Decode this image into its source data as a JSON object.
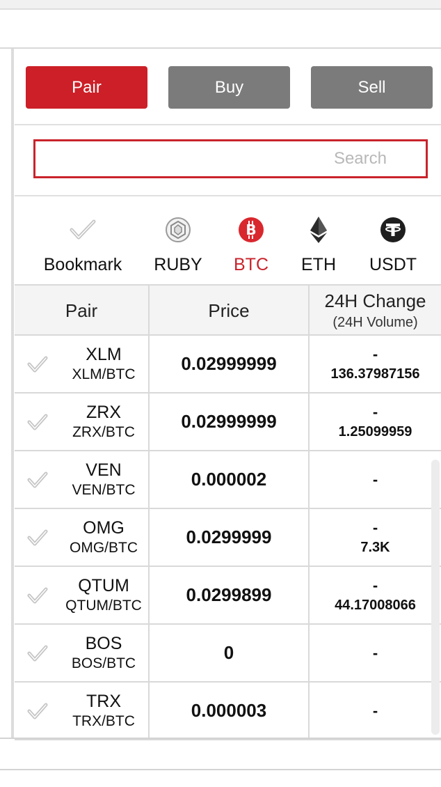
{
  "tabs": [
    {
      "label": "Pair",
      "active": true
    },
    {
      "label": "Buy",
      "active": false
    },
    {
      "label": "Sell",
      "active": false
    }
  ],
  "search": {
    "placeholder": "Search",
    "value": ""
  },
  "markets": [
    {
      "label": "Bookmark",
      "icon": "check-icon",
      "active": false
    },
    {
      "label": "RUBY",
      "icon": "ruby-gem-icon",
      "active": false
    },
    {
      "label": "BTC",
      "icon": "bitcoin-icon",
      "active": true
    },
    {
      "label": "ETH",
      "icon": "ethereum-icon",
      "active": false
    },
    {
      "label": "USDT",
      "icon": "tether-icon",
      "active": false
    }
  ],
  "table": {
    "headers": {
      "pair": "Pair",
      "price": "Price",
      "change": "24H Change",
      "volume": "(24H Volume)"
    },
    "rows": [
      {
        "symbol": "XLM",
        "pair": "XLM/BTC",
        "price": "0.02999999",
        "change": "-",
        "volume": "136.37987156"
      },
      {
        "symbol": "ZRX",
        "pair": "ZRX/BTC",
        "price": "0.02999999",
        "change": "-",
        "volume": "1.25099959"
      },
      {
        "symbol": "VEN",
        "pair": "VEN/BTC",
        "price": "0.000002",
        "change": "-",
        "volume": ""
      },
      {
        "symbol": "OMG",
        "pair": "OMG/BTC",
        "price": "0.0299999",
        "change": "-",
        "volume": "7.3K"
      },
      {
        "symbol": "QTUM",
        "pair": "QTUM/BTC",
        "price": "0.0299899",
        "change": "-",
        "volume": "44.17008066"
      },
      {
        "symbol": "BOS",
        "pair": "BOS/BTC",
        "price": "0",
        "change": "-",
        "volume": ""
      },
      {
        "symbol": "TRX",
        "pair": "TRX/BTC",
        "price": "0.000003",
        "change": "-",
        "volume": ""
      }
    ]
  },
  "colors": {
    "accent": "#cc1f27",
    "inactive_tab": "#7b7b7b",
    "header_bg": "#f4f4f4"
  }
}
